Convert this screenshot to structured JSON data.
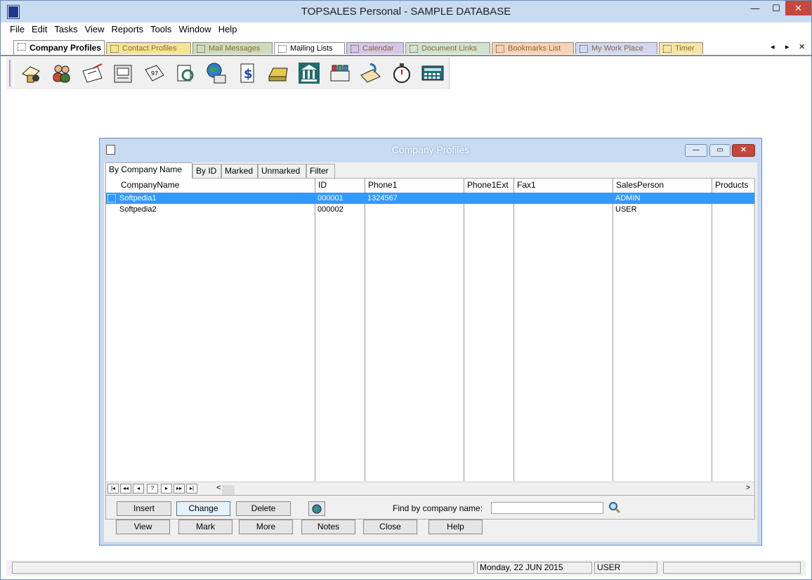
{
  "window": {
    "title": "TOPSALES Personal - SAMPLE DATABASE",
    "minimize": "—",
    "maximize": "☐",
    "close": "✕"
  },
  "menu": [
    "File",
    "Edit",
    "Tasks",
    "View",
    "Reports",
    "Tools",
    "Window",
    "Help"
  ],
  "module_tabs": [
    {
      "label": "Company Profiles",
      "color": "#ffffff"
    },
    {
      "label": "Contact Profiles",
      "color": "#f4e596"
    },
    {
      "label": "Mail Messages",
      "color": "#cfdcbc"
    },
    {
      "label": "Mailing Lists",
      "color": "#ffffff"
    },
    {
      "label": "Calendar",
      "color": "#d6c6ea"
    },
    {
      "label": "Document Links",
      "color": "#cfe3cf"
    },
    {
      "label": "Bookmarks List",
      "color": "#f7d2b5"
    },
    {
      "label": "My Work Place",
      "color": "#d1d8f0"
    },
    {
      "label": "Timer",
      "color": "#f6e6a3"
    }
  ],
  "tab_scroll": {
    "left": "◂",
    "right": "▸",
    "close": "✕"
  },
  "toolbar_icons": [
    "company-profiles-icon",
    "contacts-icon",
    "mail-icon",
    "mailing-lists-icon",
    "calendar-icon",
    "document-links-icon",
    "bookmarks-icon",
    "workplace-icon",
    "billing-icon",
    "cash-register-icon",
    "bank-icon",
    "shop-icon",
    "hand-note-icon",
    "timer-icon",
    "calculator-icon"
  ],
  "child": {
    "title": "Company Profiles",
    "min": "—",
    "max": "▭",
    "close": "✕"
  },
  "subtabs": [
    "By Company Name",
    "By ID",
    "Marked",
    "Unmarked",
    "Filter"
  ],
  "grid": {
    "columns": [
      "CompanyName",
      "ID",
      "Phone1",
      "Phone1Ext",
      "Fax1",
      "SalesPerson",
      "Products"
    ],
    "rows": [
      {
        "company": "Softpedia1",
        "id": "000001",
        "phone1": "1324567",
        "ext": "",
        "fax": "",
        "sales": "ADMIN",
        "products": "",
        "selected": true
      },
      {
        "company": "Softpedia2",
        "id": "000002",
        "phone1": "",
        "ext": "",
        "fax": "",
        "sales": "USER",
        "products": "",
        "selected": false
      }
    ]
  },
  "nav_buttons": [
    "|◂",
    "◂◂",
    "◂",
    "?",
    "▸",
    "▸▸",
    "▸|"
  ],
  "scroll": {
    "left": "<",
    "right": ">"
  },
  "buttons_row1": [
    "Insert",
    "Change",
    "Delete"
  ],
  "find": {
    "label": "Find by company name:",
    "value": "",
    "placeholder": ""
  },
  "buttons_row2": [
    "View",
    "Mark",
    "More",
    "Notes",
    "Close",
    "Help"
  ],
  "status": {
    "date": "Monday, 22 JUN 2015",
    "user": "USER"
  },
  "colors": {
    "titlebar": "#c8dbf1",
    "selection": "#3399ff",
    "accent": "#3c7fb1"
  }
}
